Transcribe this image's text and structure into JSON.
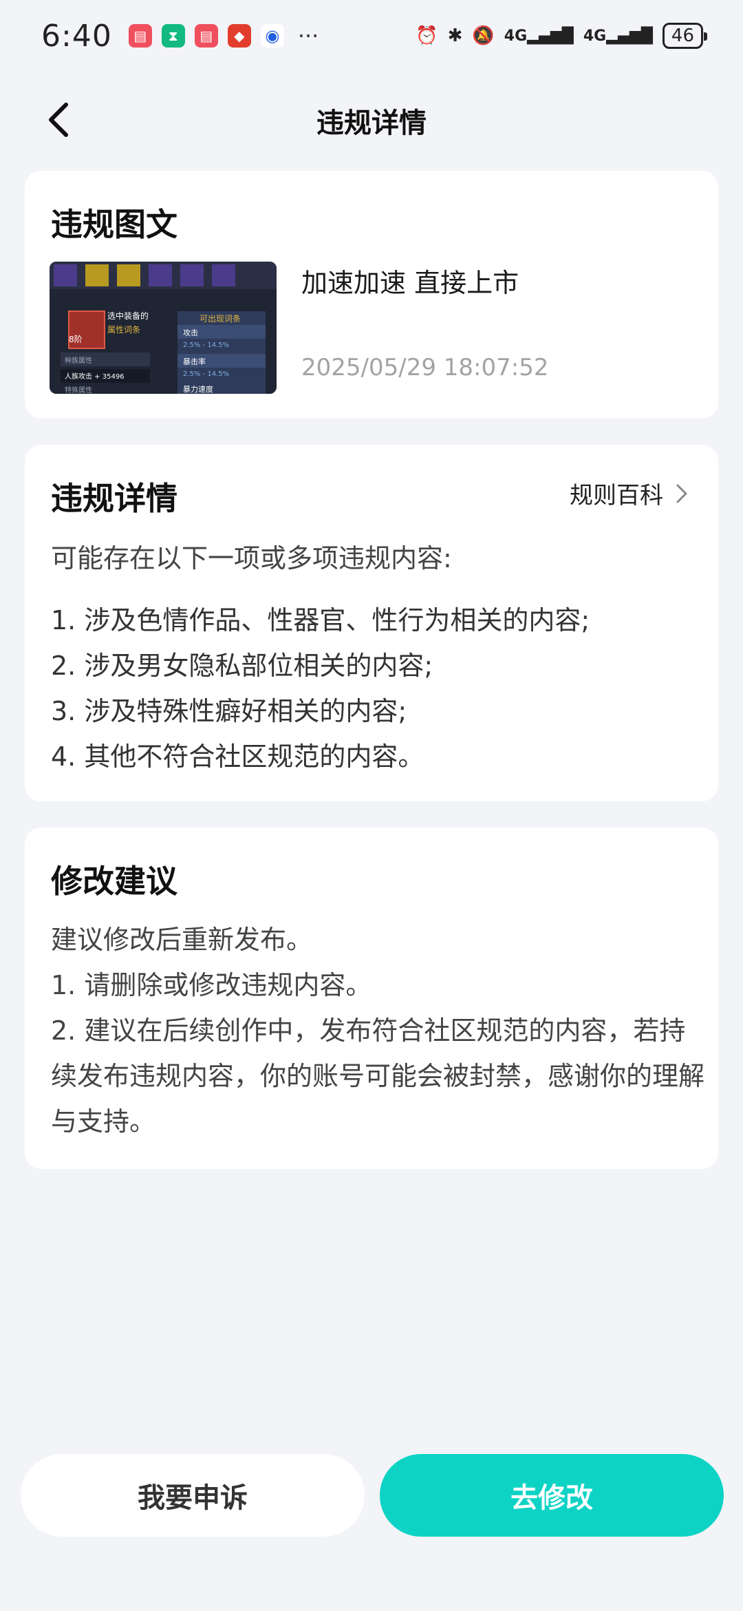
{
  "status_bar": {
    "time": "6:40",
    "signal1": "4G",
    "signal2": "4G",
    "battery": "46"
  },
  "header": {
    "title": "违规详情"
  },
  "violation_post": {
    "section_title": "违规图文",
    "text": "加速加速 直接上市",
    "timestamp": "2025/05/29 18:07:52",
    "thumbnail": {
      "selected_label": "选中装备的",
      "attr_label": "属性词条",
      "available_label": "可出现词条",
      "row1": "攻击",
      "row2": "2.5% - 14.5%",
      "row3": "暴击率",
      "row4": "2.5% - 14.5%",
      "row5": "暴力速度",
      "race_label": "种族属性",
      "race_value": "人族攻击 + 35496",
      "special_label": "特殊属性",
      "level": "8阶"
    }
  },
  "violation_detail": {
    "section_title": "违规详情",
    "rules_link": "规则百科",
    "intro": "可能存在以下一项或多项违规内容:",
    "items": [
      "1. 涉及色情作品、性器官、性行为相关的内容;",
      "2. 涉及男女隐私部位相关的内容;",
      "3. 涉及特殊性癖好相关的内容;",
      "4. 其他不符合社区规范的内容。"
    ]
  },
  "suggestion": {
    "section_title": "修改建议",
    "lines": [
      "建议修改后重新发布。",
      "1. 请删除或修改违规内容。",
      "2. 建议在后续创作中，发布符合社区规范的内容，若持续发布违规内容，你的账号可能会被封禁，感谢你的理解与支持。"
    ]
  },
  "actions": {
    "appeal": "我要申诉",
    "edit": "去修改"
  },
  "colors": {
    "accent": "#0dd3c5",
    "background": "#f3f4f8"
  }
}
